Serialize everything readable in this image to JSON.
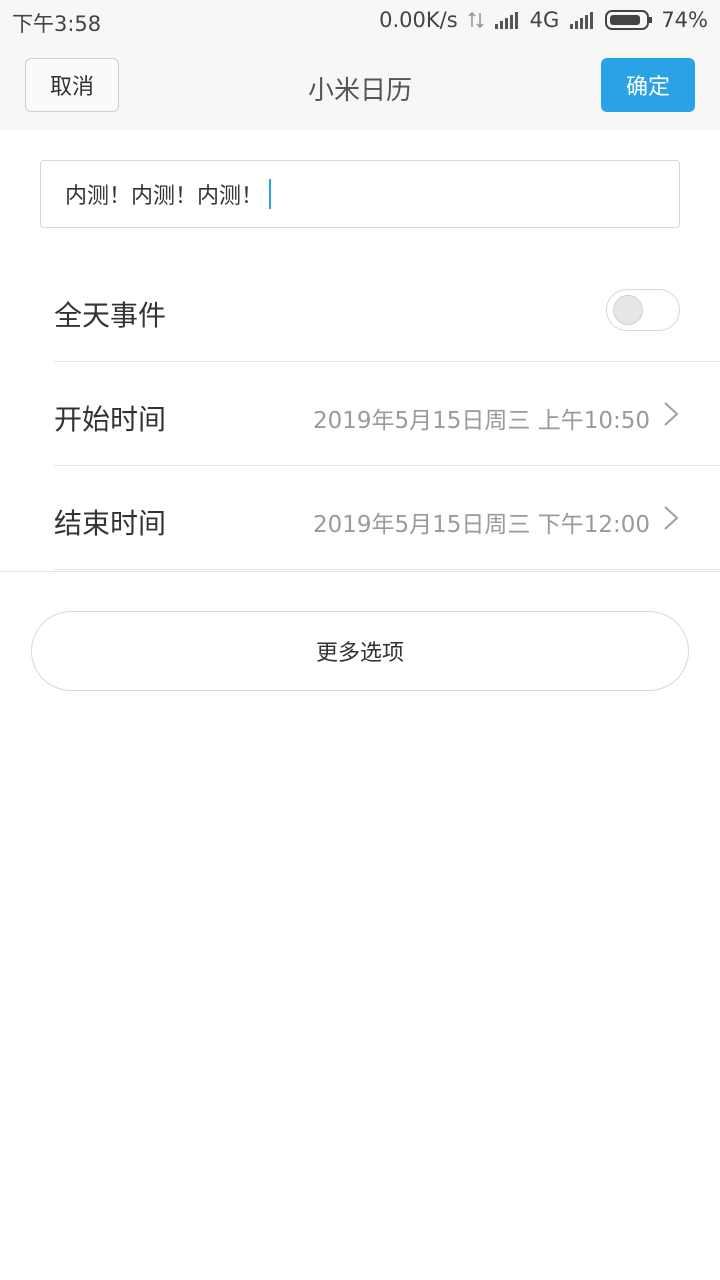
{
  "status_bar": {
    "time": "下午3:58",
    "net_speed": "0.00K/s",
    "network": "4G",
    "battery": "74%"
  },
  "header": {
    "cancel_label": "取消",
    "title": "小米日历",
    "confirm_label": "确定",
    "accent_color": "#2aa3e6"
  },
  "event": {
    "title_value": "内测！内测！内测！"
  },
  "settings": {
    "all_day": {
      "label": "全天事件",
      "enabled": false
    },
    "start": {
      "label": "开始时间",
      "value": "2019年5月15日周三 上午10:50"
    },
    "end": {
      "label": "结束时间",
      "value": "2019年5月15日周三 下午12:00"
    }
  },
  "more_options_label": "更多选项",
  "icons": [
    "data-arrows-icon",
    "signal-icon",
    "battery-icon",
    "chevron-right-icon"
  ]
}
